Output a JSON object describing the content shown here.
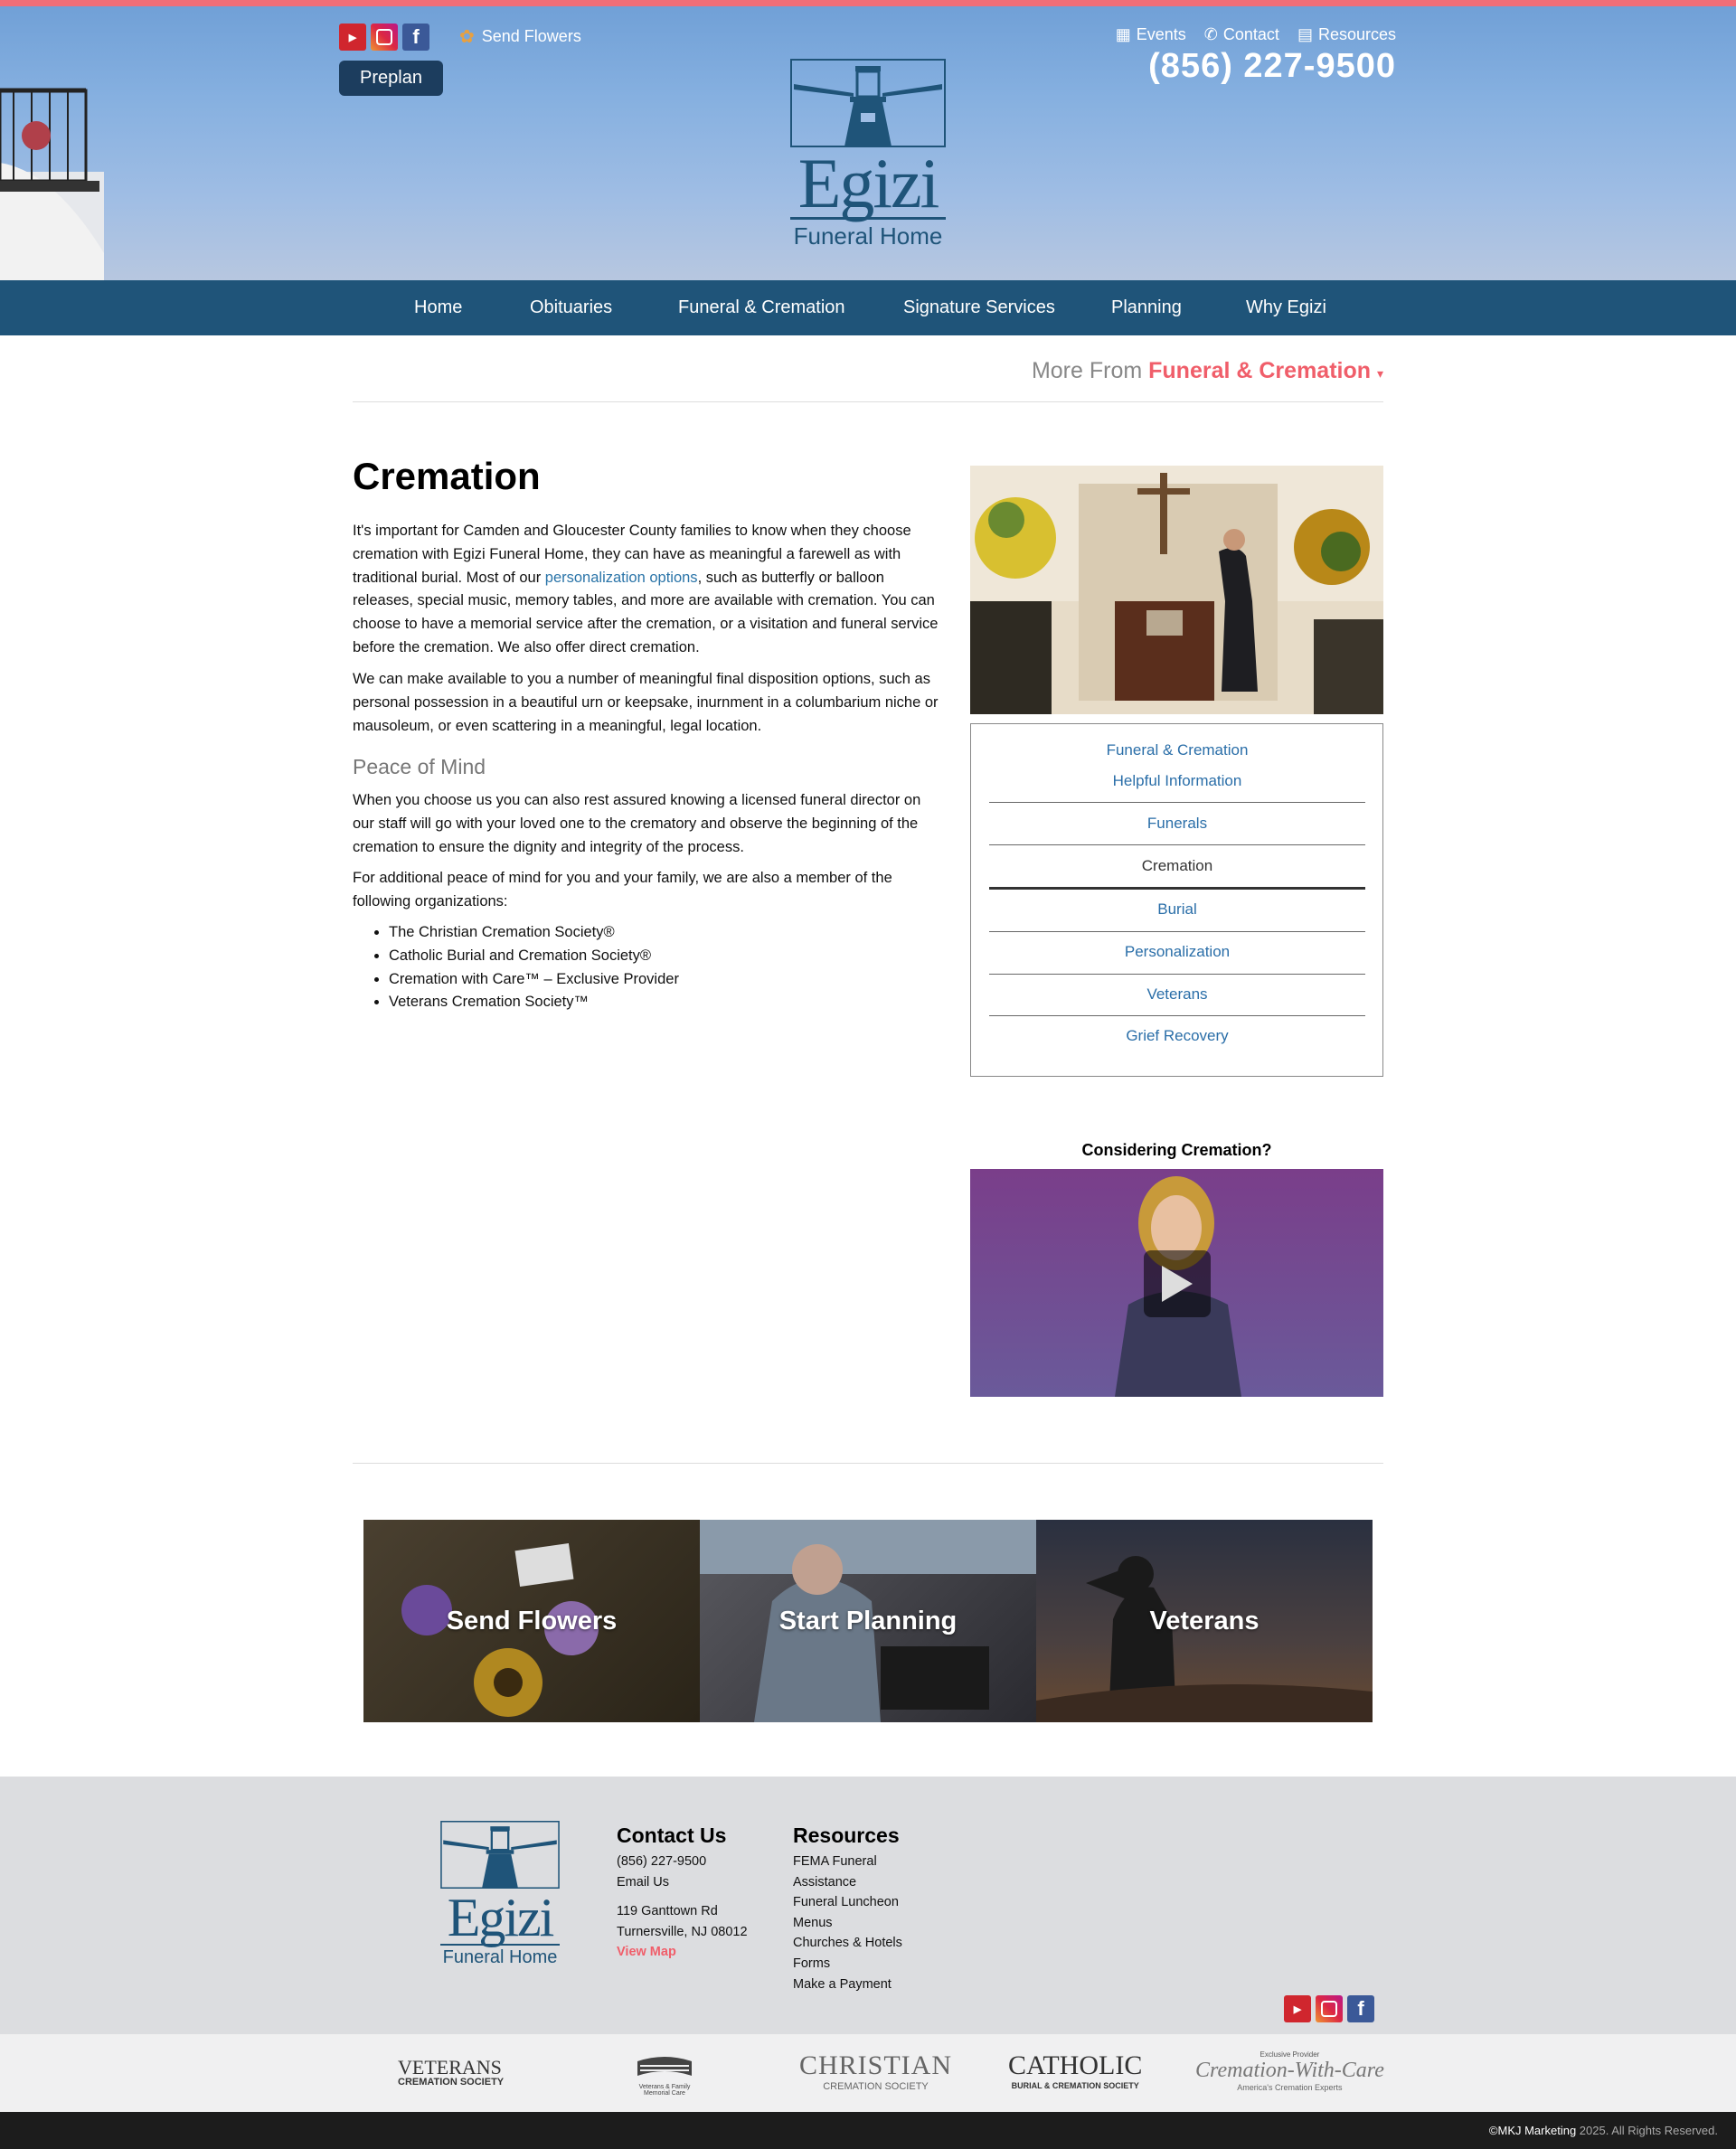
{
  "header": {
    "send_flowers": "Send Flowers",
    "preplan": "Preplan",
    "links": [
      "Events",
      "Contact",
      "Resources"
    ],
    "phone": "(856) 227-9500",
    "logo_name": "Egizi",
    "logo_sub": "Funeral Home",
    "social": [
      "youtube",
      "instagram",
      "facebook"
    ]
  },
  "nav": [
    "Home",
    "Obituaries",
    "Funeral & Cremation",
    "Signature Services",
    "Planning",
    "Why Egizi"
  ],
  "more_from": {
    "prefix": "More From",
    "section": "Funeral & Cremation",
    "caret": "▾"
  },
  "main": {
    "title": "Cremation",
    "p1_before": "It's important for Camden and Gloucester County families to know when they choose cremation with Egizi Funeral Home, they can have as meaningful a farewell as with traditional burial. Most of our ",
    "p1_link": "personalization options",
    "p1_after": ", such as butterfly or balloon releases, special music, memory tables, and more are available with cremation. You can choose to have a memorial service after the cremation, or a visitation and funeral service before the cremation. We also offer direct cremation.",
    "p2": "We can make available to you a number of meaningful final disposition options, such as personal possession in a beautiful urn or keepsake, inurnment in a columbarium niche or mausoleum, or even scattering in a meaningful, legal location.",
    "subhead": "Peace of Mind",
    "p3": "When you choose us you can also rest assured knowing a licensed funeral director on our staff will go with your loved one to the crematory and observe the beginning of the cremation to ensure the dignity and integrity of the process.",
    "p4": "For additional peace of mind for you and your family, we are also a member of the following organizations:",
    "orgs": [
      "The Christian Cremation Society®",
      "Catholic Burial and Cremation Society®",
      "Cremation with Care™ – Exclusive Provider",
      "Veterans Cremation Society™"
    ]
  },
  "sidebar": {
    "items": [
      "Funeral & Cremation",
      "Helpful Information",
      "Funerals",
      "Cremation",
      "Burial",
      "Personalization",
      "Veterans",
      "Grief Recovery"
    ],
    "video_label": "Considering Cremation?"
  },
  "tiles": [
    "Send Flowers",
    "Start Planning",
    "Veterans"
  ],
  "footer": {
    "contact_head": "Contact Us",
    "phone": "(856) 227-9500",
    "email": "Email Us",
    "addr1": "119 Ganttown Rd",
    "addr2": "Turnersville, NJ 08012",
    "map": "View Map",
    "resources_head": "Resources",
    "resources": [
      "FEMA Funeral",
      "Assistance",
      "Funeral Luncheon",
      "Menus",
      "Churches & Hotels",
      "Forms",
      "Make a Payment"
    ],
    "assoc": {
      "vet1": "VETERANS",
      "vet2": "CREMATION SOCIETY",
      "vm": "Veterans & Family Memorial Care",
      "christian1": "CHRISTIAN",
      "christian2": "CREMATION SOCIETY",
      "catholic1": "CATHOLIC",
      "catholic2": "BURIAL & CREMATION SOCIETY",
      "cwc_top": "Exclusive Provider",
      "cwc": "Cremation-With-Care",
      "cwc_sub": "America's Cremation Experts"
    },
    "copyright_brand": "©MKJ Marketing",
    "copyright_rest": " 2025. All Rights Reserved."
  },
  "colors": {
    "nav": "#1f5479",
    "accent": "#f05e6a",
    "link": "#2a6ea8",
    "footer": "#dcdde0"
  }
}
